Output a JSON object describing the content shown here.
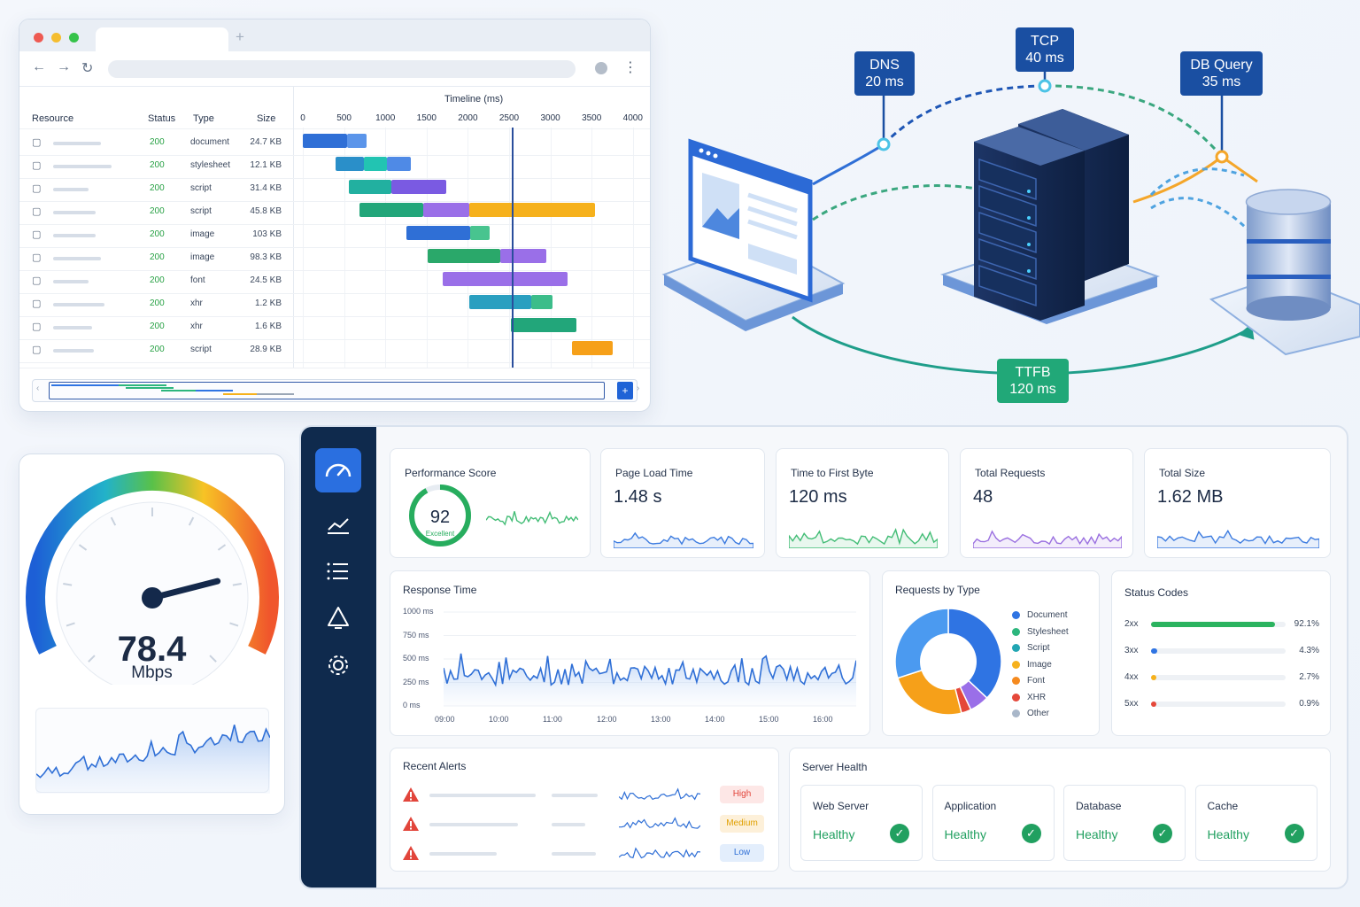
{
  "waterfall": {
    "headers": {
      "resource": "Resource",
      "status": "Status",
      "type": "Type",
      "size": "Size",
      "timeline": "Timeline (ms)"
    },
    "ticks": [
      "0",
      "500",
      "1000",
      "1500",
      "2000",
      "2500",
      "3000",
      "3500",
      "4000"
    ],
    "rows": [
      {
        "status": "200",
        "type": "document",
        "size": "24.7 KB"
      },
      {
        "status": "200",
        "type": "stylesheet",
        "size": "12.1 KB"
      },
      {
        "status": "200",
        "type": "script",
        "size": "31.4 KB"
      },
      {
        "status": "200",
        "type": "script",
        "size": "45.8 KB"
      },
      {
        "status": "200",
        "type": "image",
        "size": "103 KB"
      },
      {
        "status": "200",
        "type": "image",
        "size": "98.3 KB"
      },
      {
        "status": "200",
        "type": "font",
        "size": "24.5 KB"
      },
      {
        "status": "200",
        "type": "xhr",
        "size": "1.2 KB"
      },
      {
        "status": "200",
        "type": "xhr",
        "size": "1.6 KB"
      },
      {
        "status": "200",
        "type": "script",
        "size": "28.9 KB"
      }
    ],
    "overview_button": "+"
  },
  "diagram": {
    "dns": {
      "name": "DNS",
      "value": "20 ms"
    },
    "tcp": {
      "name": "TCP",
      "value": "40 ms"
    },
    "db": {
      "name": "DB Query",
      "value": "35 ms"
    },
    "ttfb": {
      "name": "TTFB",
      "value": "120 ms"
    }
  },
  "speed": {
    "value": "78.4",
    "unit": "Mbps",
    "gauge_fraction": 0.78
  },
  "metrics": {
    "performance": {
      "title": "Performance Score",
      "value": "92",
      "caption": "Excellent",
      "score": 92
    },
    "page_load": {
      "title": "Page Load Time",
      "value": "1.48 s"
    },
    "ttfb": {
      "title": "Time to First Byte",
      "value": "120 ms"
    },
    "requests": {
      "title": "Total Requests",
      "value": "48"
    },
    "size": {
      "title": "Total Size",
      "value": "1.62 MB"
    }
  },
  "response_time": {
    "title": "Response Time",
    "y_labels": [
      "1000 ms",
      "750 ms",
      "500 ms",
      "250 ms",
      "0 ms"
    ],
    "x_labels": [
      "09:00",
      "10:00",
      "11:00",
      "12:00",
      "13:00",
      "14:00",
      "15:00",
      "16:00"
    ]
  },
  "requests_by_type": {
    "title": "Requests by Type",
    "items": [
      {
        "label": "Document",
        "color": "#2f74e3"
      },
      {
        "label": "Stylesheet",
        "color": "#2cb67d"
      },
      {
        "label": "Script",
        "color": "#22a6b3"
      },
      {
        "label": "Image",
        "color": "#f6b11c"
      },
      {
        "label": "Font",
        "color": "#f58a1f"
      },
      {
        "label": "XHR",
        "color": "#e5483a"
      },
      {
        "label": "Other",
        "color": "#a9b7c9"
      }
    ]
  },
  "status_codes": {
    "title": "Status Codes",
    "items": [
      {
        "code": "2xx",
        "pct": "92.1%",
        "fraction": 0.921,
        "color": "#2bb35f"
      },
      {
        "code": "3xx",
        "pct": "4.3%",
        "fraction": 0.043,
        "color": "#2f74e3"
      },
      {
        "code": "4xx",
        "pct": "2.7%",
        "fraction": 0.027,
        "color": "#f6b11c"
      },
      {
        "code": "5xx",
        "pct": "0.9%",
        "fraction": 0.009,
        "color": "#e5483a"
      }
    ]
  },
  "alerts": {
    "title": "Recent Alerts",
    "items": [
      {
        "level": "High"
      },
      {
        "level": "Medium"
      },
      {
        "level": "Low"
      }
    ]
  },
  "server_health": {
    "title": "Server Health",
    "items": [
      {
        "name": "Web Server",
        "status": "Healthy"
      },
      {
        "name": "Application",
        "status": "Healthy"
      },
      {
        "name": "Database",
        "status": "Healthy"
      },
      {
        "name": "Cache",
        "status": "Healthy"
      }
    ]
  }
}
